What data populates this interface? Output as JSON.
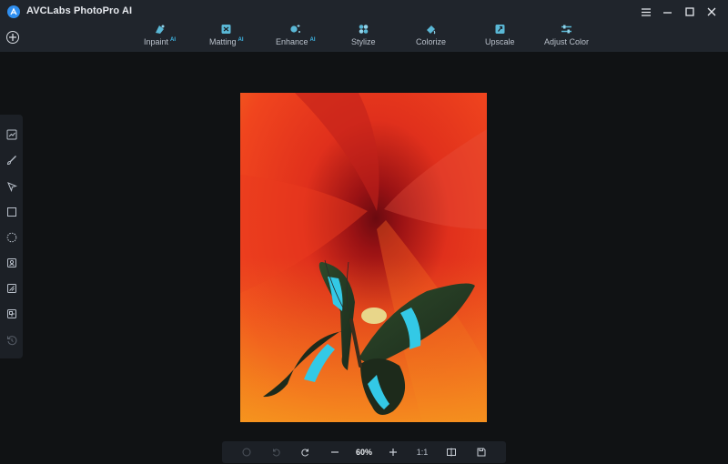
{
  "app": {
    "title": "AVCLabs PhotoPro AI"
  },
  "tabs": [
    {
      "label": "Inpaint",
      "ai": "AI",
      "icon": "inpaint-icon"
    },
    {
      "label": "Matting",
      "ai": "AI",
      "icon": "matting-icon"
    },
    {
      "label": "Enhance",
      "ai": "AI",
      "icon": "enhance-icon"
    },
    {
      "label": "Stylize",
      "ai": "",
      "icon": "stylize-icon"
    },
    {
      "label": "Colorize",
      "ai": "",
      "icon": "colorize-icon"
    },
    {
      "label": "Upscale",
      "ai": "",
      "icon": "upscale-icon"
    },
    {
      "label": "Adjust Color",
      "ai": "",
      "icon": "adjust-color-icon"
    }
  ],
  "window_controls": [
    "menu-icon",
    "minimize-icon",
    "maximize-icon",
    "close-icon"
  ],
  "left_tools": [
    "compare-icon",
    "brush-icon",
    "select-arrow-icon",
    "rectangle-select-icon",
    "lasso-icon",
    "portrait-icon",
    "object-icon",
    "layers-icon",
    "history-icon"
  ],
  "bottom": {
    "zoom": "60%",
    "ratio": "1:1"
  },
  "colors": {
    "accent": "#3fb7e6",
    "titlebar": "#20252c",
    "background": "#101214"
  }
}
